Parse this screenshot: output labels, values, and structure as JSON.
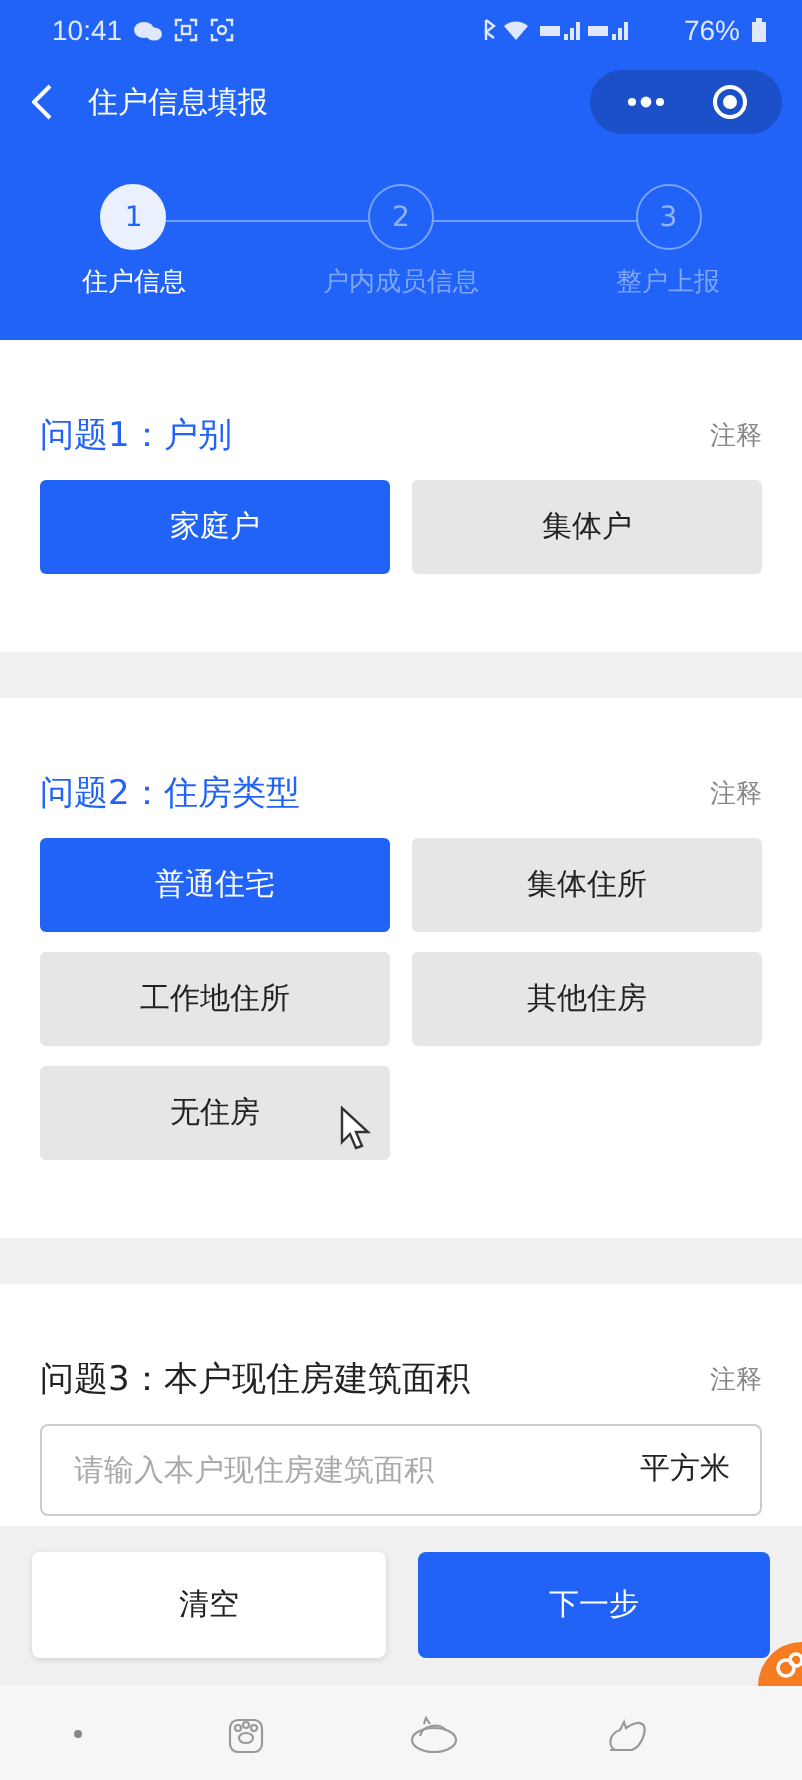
{
  "status_bar": {
    "time": "10:41",
    "battery": "76%"
  },
  "nav": {
    "title": "住户信息填报"
  },
  "steps": [
    {
      "number": "1",
      "label": "住户信息",
      "selected": true
    },
    {
      "number": "2",
      "label": "户内成员信息",
      "selected": false
    },
    {
      "number": "3",
      "label": "整户上报",
      "selected": false
    }
  ],
  "questions": [
    {
      "kind": "choice",
      "title": "问题1：户别",
      "highlighted": true,
      "note": "注释",
      "options": [
        {
          "label": "家庭户",
          "selected": true
        },
        {
          "label": "集体户",
          "selected": false
        }
      ]
    },
    {
      "kind": "choice",
      "title": "问题2：住房类型",
      "highlighted": true,
      "note": "注释",
      "options": [
        {
          "label": "普通住宅",
          "selected": true
        },
        {
          "label": "集体住所",
          "selected": false
        },
        {
          "label": "工作地住所",
          "selected": false
        },
        {
          "label": "其他住房",
          "selected": false
        },
        {
          "label": "无住房",
          "selected": false
        }
      ]
    },
    {
      "kind": "input",
      "title": "问题3：本户现住房建筑面积",
      "highlighted": false,
      "note": "注释",
      "placeholder": "请输入本户现住房建筑面积",
      "unit": "平方米"
    }
  ],
  "footer": {
    "buttons": [
      {
        "label": "清空",
        "kind": "secondary"
      },
      {
        "label": "下一步",
        "kind": "primary"
      }
    ]
  }
}
